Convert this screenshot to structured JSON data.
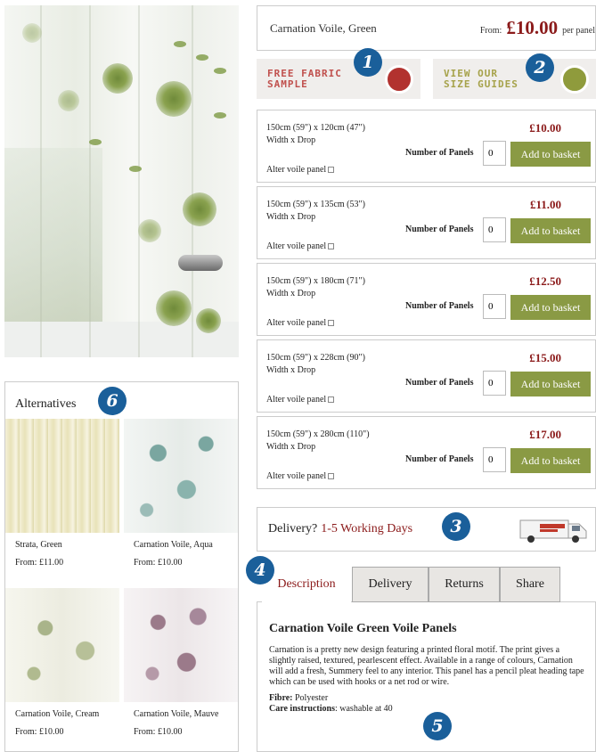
{
  "product": {
    "name": "Carnation Voile, Green",
    "from_label": "From:",
    "price": "£10.00",
    "per_label": "per panel"
  },
  "promos": {
    "sample_line1": "FREE FABRIC",
    "sample_line2": "SAMPLE",
    "size_line1": "VIEW OUR",
    "size_line2": "SIZE GUIDES"
  },
  "badges": [
    "1",
    "2",
    "3",
    "4",
    "5",
    "6"
  ],
  "sizes": {
    "width_drop_label": "Width x Drop",
    "number_of_panels_label": "Number of Panels",
    "alter_label": "Alter voile panel",
    "add_label": "Add to basket",
    "rows": [
      {
        "size": "150cm (59\") x 120cm (47\")",
        "price": "£10.00",
        "qty": "0"
      },
      {
        "size": "150cm (59\") x 135cm (53\")",
        "price": "£11.00",
        "qty": "0"
      },
      {
        "size": "150cm (59\") x 180cm (71\")",
        "price": "£12.50",
        "qty": "0"
      },
      {
        "size": "150cm (59\") x 228cm (90\")",
        "price": "£15.00",
        "qty": "0"
      },
      {
        "size": "150cm (59\") x 280cm (110\")",
        "price": "£17.00",
        "qty": "0"
      }
    ]
  },
  "delivery": {
    "question": "Delivery?",
    "value": "1-5 Working Days"
  },
  "tabs": [
    "Description",
    "Delivery",
    "Returns",
    "Share"
  ],
  "description": {
    "heading": "Carnation Voile Green Voile Panels",
    "body": "Carnation is a pretty new design featuring a printed floral motif. The print gives a slightly raised, textured, pearlescent effect. Available in a range of colours, Carnation will add a fresh, Summery feel to any interior. This panel has a pencil pleat heading tape which can be used with hooks or a net rod or wire.",
    "fibre_label": "Fibre:",
    "fibre_value": "Polyester",
    "care_label": "Care instructions",
    "care_value": ": washable at 40"
  },
  "alternatives": {
    "title": "Alternatives",
    "items": [
      {
        "name": "Strata, Green",
        "price": "From: £11.00"
      },
      {
        "name": "Carnation Voile, Aqua",
        "price": "From: £10.00"
      },
      {
        "name": "Carnation Voile, Cream",
        "price": "From: £10.00"
      },
      {
        "name": "Carnation Voile, Mauve",
        "price": "From: £10.00"
      }
    ]
  },
  "colors": {
    "price_red": "#8b1a1a",
    "button_green": "#8a9a44",
    "badge_blue": "#1a5f9a"
  }
}
